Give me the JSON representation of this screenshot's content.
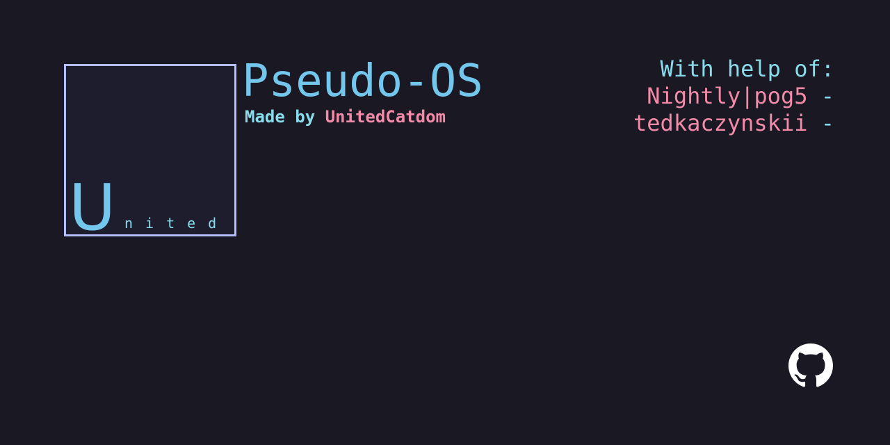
{
  "logo": {
    "big_letter": "U",
    "small_letters": "nited",
    "border_color": "#b4befe",
    "text_color": "#74c7ec"
  },
  "header": {
    "title": "Pseudo-OS",
    "made_by_prefix": "Made by",
    "author": "UnitedCatdom"
  },
  "credits": {
    "heading": "With help of:",
    "contributors": [
      {
        "name": "Nightly|pog5",
        "suffix": " -"
      },
      {
        "name": "tedkaczynskii",
        "suffix": " -"
      }
    ]
  },
  "footer": {
    "icon": "github-icon"
  },
  "colors": {
    "background": "#191823",
    "accent_blue": "#74c7ec",
    "accent_pink": "#f38ba8",
    "accent_lavender": "#b4befe"
  }
}
